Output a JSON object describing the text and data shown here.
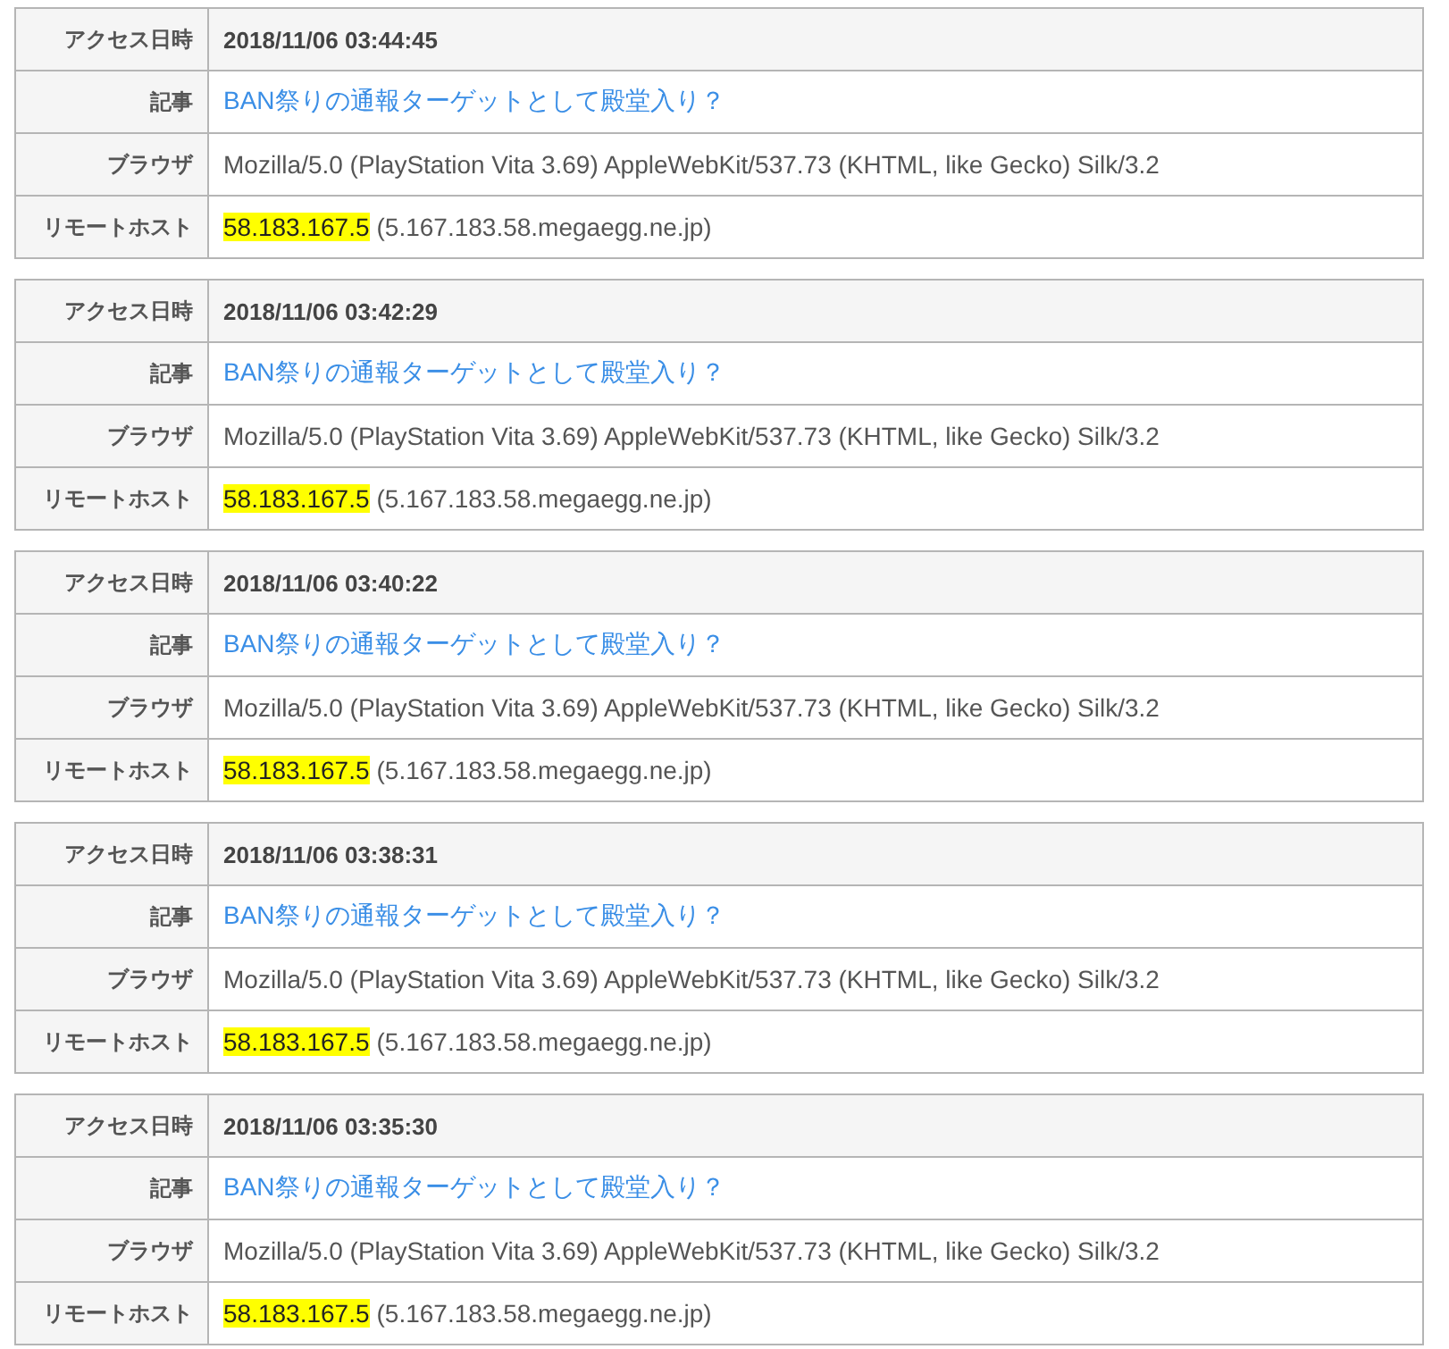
{
  "entries": [
    {
      "rows": [
        {
          "kind": "time",
          "label": "アクセス日時",
          "value": "2018/11/06 03:44:45"
        },
        {
          "kind": "link",
          "label": "記事",
          "value": "BAN祭りの通報ターゲットとして殿堂入り？"
        },
        {
          "kind": "text",
          "label": "ブラウザ",
          "value": "Mozilla/5.0 (PlayStation Vita 3.69) AppleWebKit/537.73 (KHTML, like Gecko) Silk/3.2"
        },
        {
          "kind": "host",
          "label": "リモートホスト",
          "ip": "58.183.167.5",
          "value": "(5.167.183.58.megaegg.ne.jp)"
        }
      ]
    },
    {
      "rows": [
        {
          "kind": "time",
          "label": "アクセス日時",
          "value": "2018/11/06 03:42:29"
        },
        {
          "kind": "link",
          "label": "記事",
          "value": "BAN祭りの通報ターゲットとして殿堂入り？"
        },
        {
          "kind": "text",
          "label": "ブラウザ",
          "value": "Mozilla/5.0 (PlayStation Vita 3.69) AppleWebKit/537.73 (KHTML, like Gecko) Silk/3.2"
        },
        {
          "kind": "host",
          "label": "リモートホスト",
          "ip": "58.183.167.5",
          "value": "(5.167.183.58.megaegg.ne.jp)"
        }
      ]
    },
    {
      "rows": [
        {
          "kind": "time",
          "label": "アクセス日時",
          "value": "2018/11/06 03:40:22"
        },
        {
          "kind": "link",
          "label": "記事",
          "value": "BAN祭りの通報ターゲットとして殿堂入り？"
        },
        {
          "kind": "text",
          "label": "ブラウザ",
          "value": "Mozilla/5.0 (PlayStation Vita 3.69) AppleWebKit/537.73 (KHTML, like Gecko) Silk/3.2"
        },
        {
          "kind": "host",
          "label": "リモートホスト",
          "ip": "58.183.167.5",
          "value": "(5.167.183.58.megaegg.ne.jp)"
        }
      ]
    },
    {
      "rows": [
        {
          "kind": "time",
          "label": "アクセス日時",
          "value": "2018/11/06 03:38:31"
        },
        {
          "kind": "link",
          "label": "記事",
          "value": "BAN祭りの通報ターゲットとして殿堂入り？"
        },
        {
          "kind": "text",
          "label": "ブラウザ",
          "value": "Mozilla/5.0 (PlayStation Vita 3.69) AppleWebKit/537.73 (KHTML, like Gecko) Silk/3.2"
        },
        {
          "kind": "host",
          "label": "リモートホスト",
          "ip": "58.183.167.5",
          "value": "(5.167.183.58.megaegg.ne.jp)"
        }
      ]
    },
    {
      "rows": [
        {
          "kind": "time",
          "label": "アクセス日時",
          "value": "2018/11/06 03:35:30"
        },
        {
          "kind": "link",
          "label": "記事",
          "value": "BAN祭りの通報ターゲットとして殿堂入り？"
        },
        {
          "kind": "text",
          "label": "ブラウザ",
          "value": "Mozilla/5.0 (PlayStation Vita 3.69) AppleWebKit/537.73 (KHTML, like Gecko) Silk/3.2"
        },
        {
          "kind": "host",
          "label": "リモートホスト",
          "ip": "58.183.167.5",
          "value": "(5.167.183.58.megaegg.ne.jp)"
        }
      ]
    }
  ]
}
